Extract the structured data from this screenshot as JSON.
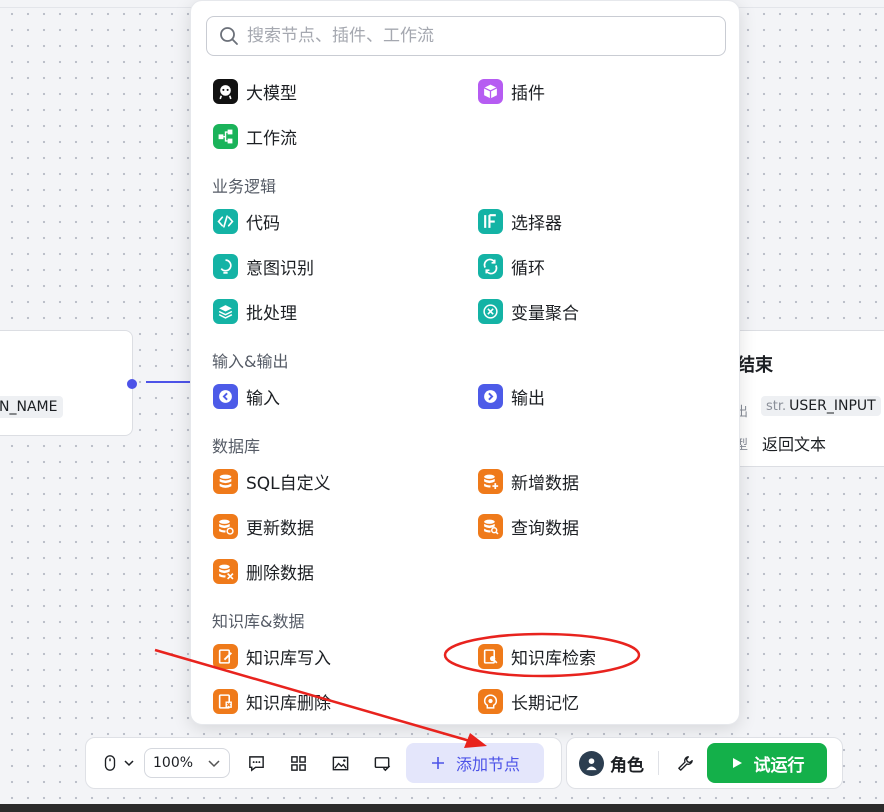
{
  "canvas": {
    "start_node": {
      "var_chip": "N_NAME"
    },
    "end_node": {
      "title": "结束",
      "output_label": "出",
      "output_prefix": "str.",
      "output_value": "USER_INPUT",
      "type_label": "型",
      "type_value": "返回文本"
    }
  },
  "popup": {
    "search_placeholder": "搜索节点、插件、工作流",
    "top_items": [
      {
        "label": "大模型",
        "icon": "llm-icon",
        "color": "#111111"
      },
      {
        "label": "插件",
        "icon": "plugin-icon",
        "color": "#b65cf2"
      },
      {
        "label": "工作流",
        "icon": "workflow-icon",
        "color": "#1ab35a"
      }
    ],
    "sections": [
      {
        "title": "业务逻辑",
        "items": [
          {
            "label": "代码",
            "icon": "code-icon"
          },
          {
            "label": "选择器",
            "icon": "if-icon"
          },
          {
            "label": "意图识别",
            "icon": "intent-icon"
          },
          {
            "label": "循环",
            "icon": "loop-icon"
          },
          {
            "label": "批处理",
            "icon": "batch-icon"
          },
          {
            "label": "变量聚合",
            "icon": "aggregate-icon"
          }
        ]
      },
      {
        "title": "输入&输出",
        "items": [
          {
            "label": "输入",
            "icon": "input-icon"
          },
          {
            "label": "输出",
            "icon": "output-icon"
          }
        ]
      },
      {
        "title": "数据库",
        "items": [
          {
            "label": "SQL自定义",
            "icon": "database-icon"
          },
          {
            "label": "新增数据",
            "icon": "database-add-icon"
          },
          {
            "label": "更新数据",
            "icon": "database-update-icon"
          },
          {
            "label": "查询数据",
            "icon": "database-query-icon"
          },
          {
            "label": "删除数据",
            "icon": "database-delete-icon"
          }
        ]
      },
      {
        "title": "知识库&数据",
        "items": [
          {
            "label": "知识库写入",
            "icon": "knowledge-write-icon"
          },
          {
            "label": "知识库检索",
            "icon": "knowledge-search-icon"
          },
          {
            "label": "知识库删除",
            "icon": "knowledge-delete-icon"
          },
          {
            "label": "长期记忆",
            "icon": "memory-icon"
          }
        ]
      }
    ]
  },
  "toolbar": {
    "zoom_value": "100%",
    "add_node_label": "添加节点",
    "role_label": "角色",
    "run_label": "试运行"
  },
  "colors": {
    "accent": "#4d53e8",
    "run_green": "#14b04a",
    "annotation_red": "#e8231e"
  }
}
